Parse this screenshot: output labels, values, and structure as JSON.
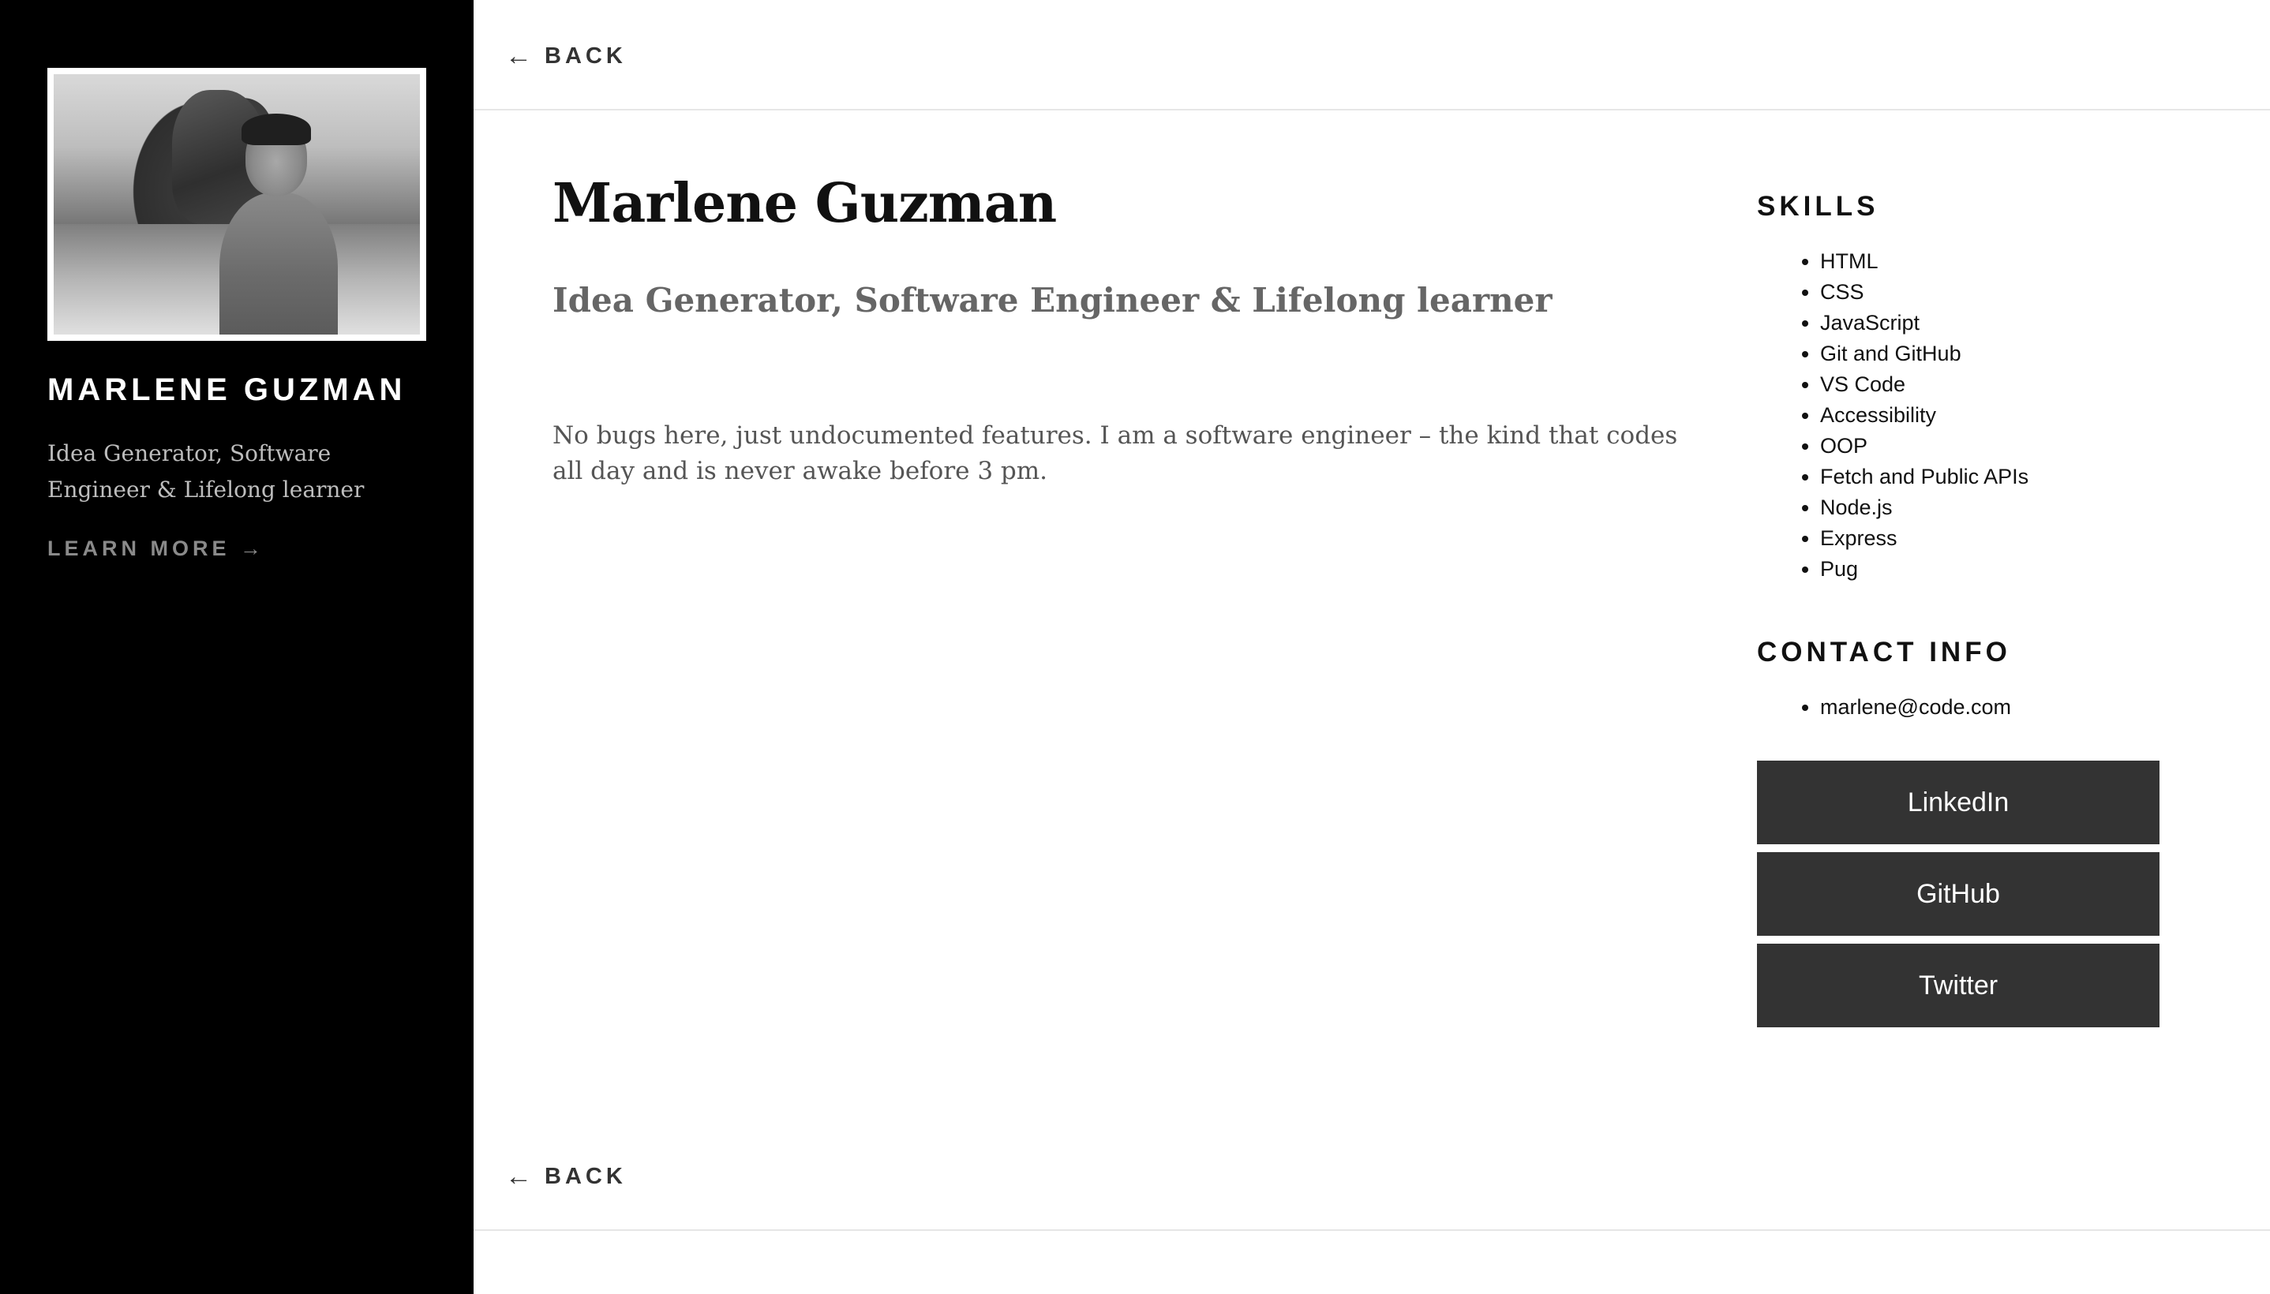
{
  "sidebar": {
    "name": "MARLENE GUZMAN",
    "tagline": "Idea Generator, Software Engineer & Lifelong learner",
    "learn_more": "LEARN MORE →"
  },
  "nav": {
    "back_label": "BACK",
    "back_icon": "←"
  },
  "main": {
    "title": "Marlene Guzman",
    "subtitle": "Idea Generator, Software Engineer & Lifelong learner",
    "bio": "No bugs here, just undocumented features. I am a software engineer – the kind that codes all day and is never awake before 3 pm."
  },
  "skills": {
    "heading": "SKILLS",
    "items": [
      "HTML",
      "CSS",
      "JavaScript",
      "Git and GitHub",
      "VS Code",
      "Accessibility",
      "OOP",
      "Fetch and Public APIs",
      "Node.js",
      "Express",
      "Pug"
    ]
  },
  "contact": {
    "heading": "CONTACT INFO",
    "items": [
      "marlene@code.com"
    ]
  },
  "social": {
    "linkedin": "LinkedIn",
    "github": "GitHub",
    "twitter": "Twitter"
  },
  "colors": {
    "sidebar_bg": "#000000",
    "button_bg": "#333333",
    "text_muted": "#666666"
  }
}
